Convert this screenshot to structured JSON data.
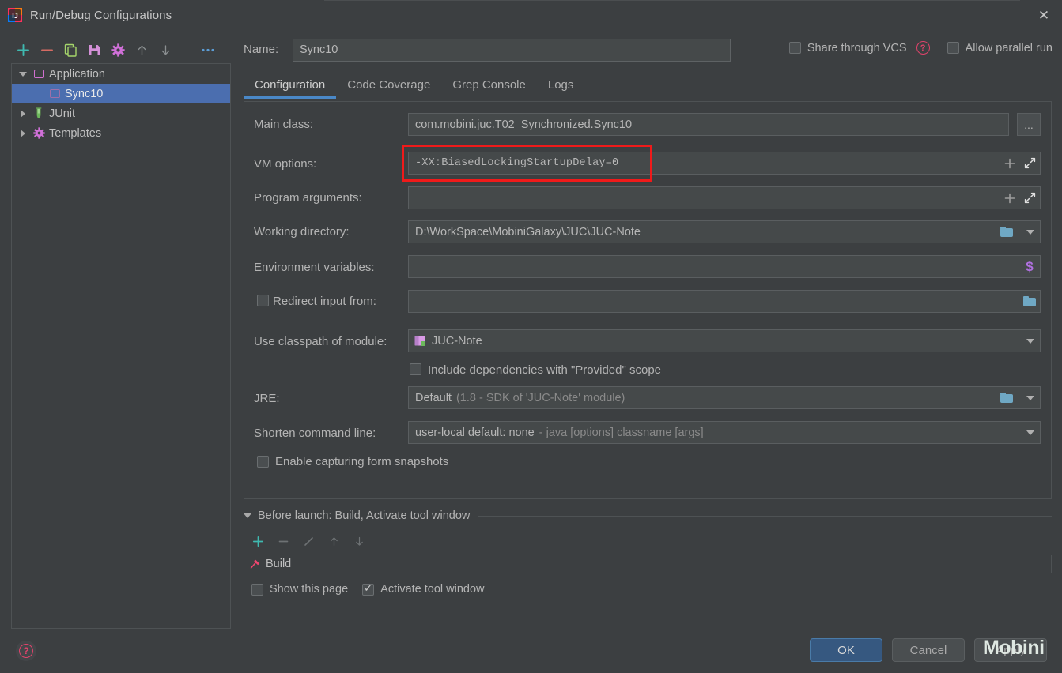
{
  "window": {
    "title": "Run/Debug Configurations",
    "app_icon": "intellij-idea-icon",
    "close_label": "✕"
  },
  "toolbar": {
    "buttons": [
      {
        "name": "add",
        "glyph": "+",
        "color": "#3fb9b0"
      },
      {
        "name": "remove",
        "glyph": "−",
        "color": "#d66b63"
      },
      {
        "name": "copy",
        "glyph": "copy-icon",
        "color": "#a5d66b"
      },
      {
        "name": "save",
        "glyph": "save-icon",
        "color": "#d490d8"
      },
      {
        "name": "edit-templates",
        "glyph": "gear-icon",
        "color": "#d070d8"
      },
      {
        "name": "move-up",
        "glyph": "↑",
        "color": "#8b8f91"
      },
      {
        "name": "move-down",
        "glyph": "↓",
        "color": "#8b8f91"
      },
      {
        "name": "more",
        "glyph": "⋯",
        "color": "#5c9dd6"
      }
    ]
  },
  "tree": {
    "items": [
      {
        "label": "Application",
        "level": 0,
        "twisty": "down",
        "icon": "application-icon",
        "selected": false
      },
      {
        "label": "Sync10",
        "level": 1,
        "twisty": "none",
        "icon": "application-icon-dim",
        "selected": true
      },
      {
        "label": "JUnit",
        "level": 0,
        "twisty": "right",
        "icon": "junit-icon",
        "selected": false
      },
      {
        "label": "Templates",
        "level": 0,
        "twisty": "right",
        "icon": "gear-icon",
        "selected": false
      }
    ]
  },
  "header": {
    "name_label": "Name:",
    "name_value": "Sync10",
    "share_vcs_label": "Share through VCS",
    "share_vcs_checked": false,
    "help_glyph": "?",
    "allow_parallel_label": "Allow parallel run",
    "allow_parallel_checked": false
  },
  "tabs": [
    {
      "label": "Configuration",
      "active": true
    },
    {
      "label": "Code Coverage",
      "active": false
    },
    {
      "label": "Grep Console",
      "active": false
    },
    {
      "label": "Logs",
      "active": false
    }
  ],
  "form": {
    "main_class": {
      "label": "Main class:",
      "value": "com.mobini.juc.T02_Synchronized.Sync10",
      "browse_label": "..."
    },
    "vm_options": {
      "label": "VM options:",
      "value": "-XX:BiasedLockingStartupDelay=0",
      "macro_glyph": "+",
      "expand_glyph": "expand-icon",
      "highlighted": true,
      "highlight_color": "#f01a1a"
    },
    "program_arguments": {
      "label": "Program arguments:",
      "value": "",
      "macro_glyph": "+",
      "expand_glyph": "expand-icon"
    },
    "working_directory": {
      "label": "Working directory:",
      "value": "D:\\WorkSpace\\MobiniGalaxy\\JUC\\JUC-Note",
      "browse_icon": "folder-icon",
      "dropdown_icon": "chevron-down-icon"
    },
    "environment_variables": {
      "label": "Environment variables:",
      "value": "",
      "macro_icon": "dollar-icon",
      "macro_glyph": "$"
    },
    "redirect_input": {
      "label": "Redirect input from:",
      "checked": false,
      "value": "",
      "browse_icon": "folder-icon"
    },
    "classpath_module": {
      "label": "Use classpath of module:",
      "value": "JUC-Note",
      "module_icon": "module-icon",
      "dropdown_icon": "chevron-down-icon"
    },
    "include_provided": {
      "label": "Include dependencies with \"Provided\" scope",
      "checked": false
    },
    "jre": {
      "label": "JRE:",
      "value": "Default",
      "value_hint": "(1.8 - SDK of 'JUC-Note' module)",
      "browse_icon": "folder-icon",
      "dropdown_icon": "chevron-down-icon"
    },
    "shorten_command_line": {
      "label": "Shorten command line:",
      "value": "user-local default: none",
      "value_hint": "- java [options] classname [args]",
      "dropdown_icon": "chevron-down-icon"
    },
    "form_snapshots": {
      "label": "Enable capturing form snapshots",
      "checked": false
    }
  },
  "before_launch": {
    "title": "Before launch: Build, Activate tool window",
    "toolbar": [
      {
        "name": "add",
        "glyph": "+",
        "color": "#3fb9b0"
      },
      {
        "name": "remove",
        "glyph": "−",
        "color": "#6e7274"
      },
      {
        "name": "edit",
        "glyph": "╱",
        "color": "#6e7274"
      },
      {
        "name": "move-up",
        "glyph": "↑",
        "color": "#6e7274"
      },
      {
        "name": "move-down",
        "glyph": "↓",
        "color": "#6e7274"
      }
    ],
    "items": [
      {
        "label": "Build",
        "icon": "build-hammer-icon"
      }
    ],
    "show_this_page": {
      "label": "Show this page",
      "checked": false
    },
    "activate_tool_window": {
      "label": "Activate tool window",
      "checked": true
    }
  },
  "footer": {
    "ok_label": "OK",
    "cancel_label": "Cancel",
    "apply_label": "Apply",
    "help_glyph": "?"
  },
  "watermark": {
    "text": "Mobini"
  }
}
